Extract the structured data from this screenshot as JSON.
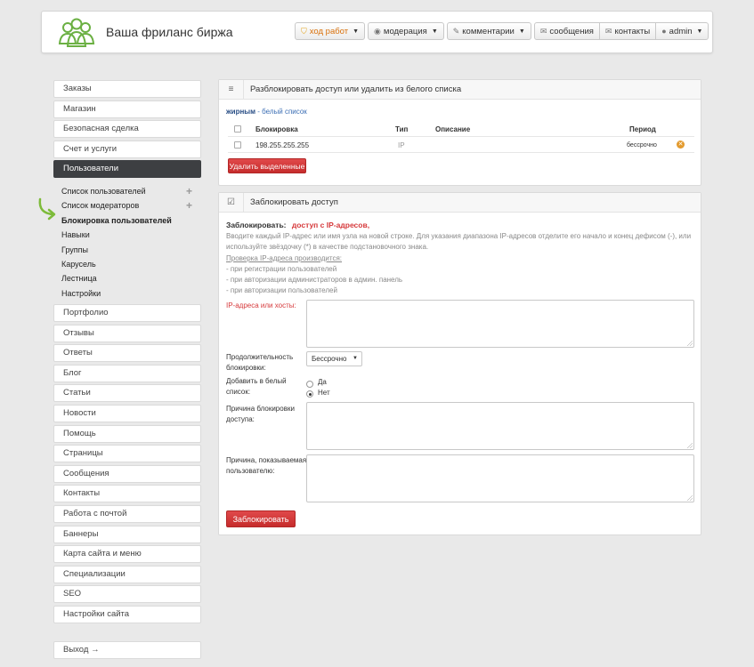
{
  "header": {
    "site_title": "Ваша фриланс биржа",
    "nav": [
      {
        "label": "ход работ",
        "icon": "shield-icon"
      },
      {
        "label": "модерация",
        "icon": "eye-icon"
      },
      {
        "label": "комментарии",
        "icon": "pencil-icon"
      },
      {
        "label": "сообщения",
        "icon": "envelope-icon"
      },
      {
        "label": "контакты",
        "icon": "contacts-icon"
      },
      {
        "label": "admin",
        "icon": "user-icon"
      }
    ]
  },
  "sidebar": {
    "top_items": [
      "Заказы",
      "Магазин",
      "Безопасная сделка",
      "Счет и услуги"
    ],
    "active_item": "Пользователи",
    "sub_items": [
      "Список пользователей",
      "Список модераторов",
      "Блокировка пользователей",
      "Навыки",
      "Группы",
      "Карусель",
      "Лестница",
      "Настройки"
    ],
    "bottom_items": [
      "Портфолио",
      "Отзывы",
      "Ответы",
      "Блог",
      "Статьи",
      "Новости",
      "Помощь",
      "Страницы",
      "Сообщения",
      "Контакты",
      "Работа с почтой",
      "Баннеры",
      "Карта сайта и меню",
      "Специализации",
      "SEO",
      "Настройки сайта"
    ],
    "logout": "Выход →"
  },
  "unblock_panel": {
    "title": "Разблокировать доступ или удалить из белого списка",
    "legend_bold": "жирным",
    "legend_rest": "- белый список",
    "columns": {
      "block": "Блокировка",
      "type": "Тип",
      "desc": "Описание",
      "period": "Период"
    },
    "rows": [
      {
        "block": "198.255.255.255",
        "type": "IP",
        "desc": "",
        "period": "бессрочно"
      }
    ],
    "delete_button": "Удалить выделенные"
  },
  "block_panel": {
    "title": "Заблокировать доступ",
    "block_label": "Заблокировать:",
    "block_value": "доступ с IP-адресов,",
    "help_line1": "Вводите каждый IP-адрес или имя узла на новой строке. Для указания диапазона IP-адресов отделите его начало и конец дефисом (-), или",
    "help_line2": "используйте звёздочку (*) в качестве подстановочного знака.",
    "check_title": "Проверка IP-адреса производится:",
    "check_items": [
      "- при регистрации пользователей",
      "- при авторизации администраторов в админ. панель",
      "- при авторизации пользователей"
    ],
    "ip_label": "IP-адреса или хосты:",
    "duration_label_1": "Продолжительность",
    "duration_label_2": "блокировки:",
    "duration_value": "Бессрочно",
    "whitelist_label_1": "Добавить в белый",
    "whitelist_label_2": "список:",
    "radio_yes": "Да",
    "radio_no": "Нет",
    "radio_selected": "Нет",
    "reason_label_1": "Причина блокировки",
    "reason_label_2": "доступа:",
    "user_reason_label_1": "Причина, показываемая",
    "user_reason_label_2": "пользователю:",
    "submit_button": "Заблокировать"
  }
}
